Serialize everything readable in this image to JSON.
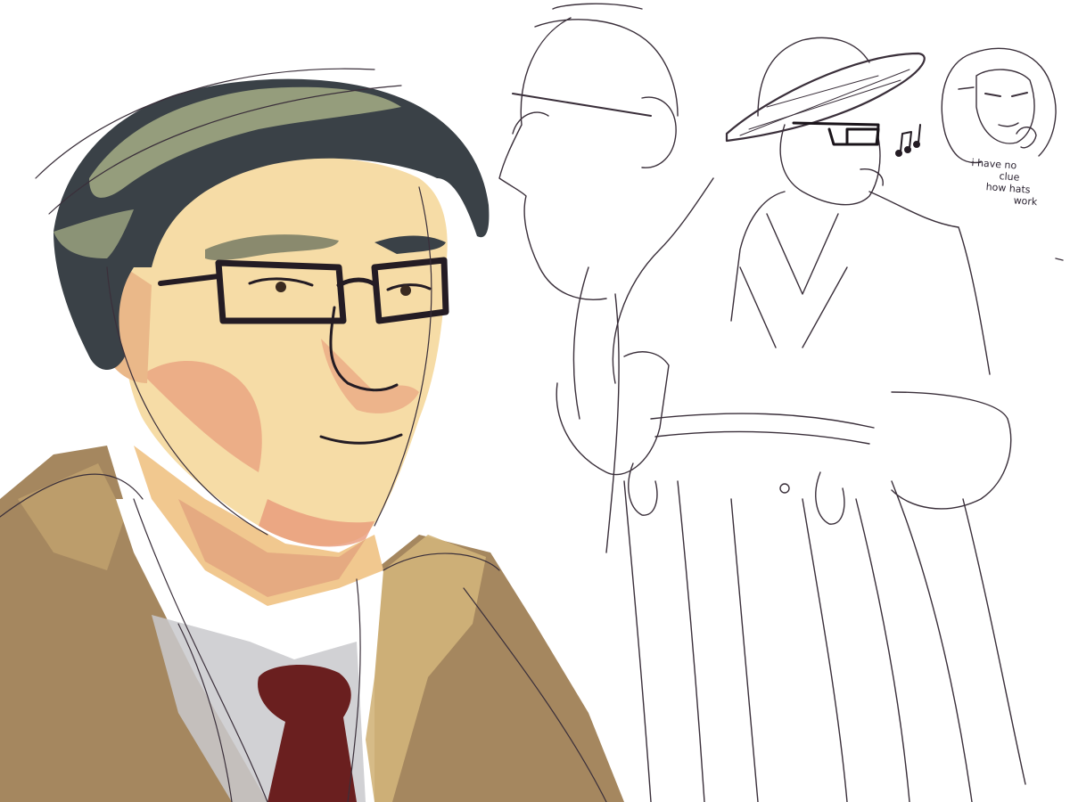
{
  "artwork": {
    "note_lines": [
      "i have no",
      "clue",
      "how hats",
      "work"
    ],
    "palette": {
      "background": "#ffffff",
      "skin": "#f6dca6",
      "skin_shadow": "#e89a7a",
      "hair": "#3a4147",
      "hair_highlight": "#9aa27f",
      "coat": "#a5875f",
      "coat_light": "#d2b47a",
      "shirt": "#ffffff",
      "shirt_shadow": "#c9c9cc",
      "tie": "#6a1f1f",
      "line": "#241c24"
    },
    "subjects": [
      "man-portrait-with-glasses",
      "man-profile-sketch",
      "man-standing-in-hat-sketch",
      "woman-doodle"
    ],
    "icons": [
      "music-notes-icon"
    ]
  }
}
